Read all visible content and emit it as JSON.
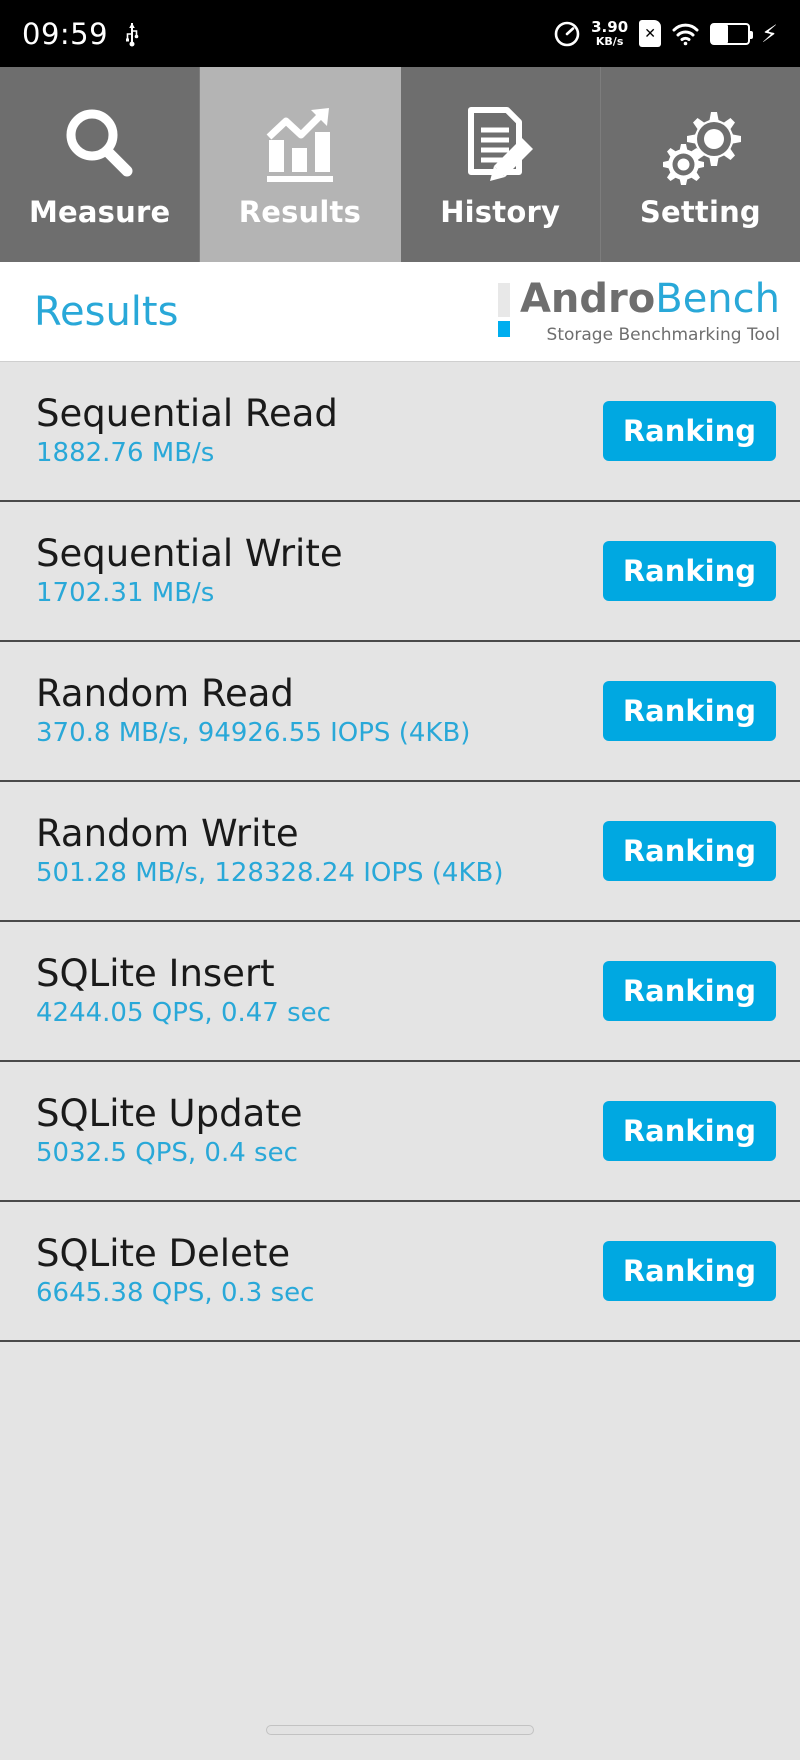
{
  "statusbar": {
    "clock": "09:59",
    "usb_icon": "usb-icon",
    "speed_icon": "speedometer-icon",
    "net_rate_value": "3.90",
    "net_rate_unit": "KB/s",
    "sim_icon": "sim-card-disabled-icon",
    "wifi_icon": "wifi-icon",
    "battery_icon": "battery-icon",
    "battery_level_percent": 45,
    "charging_icon": "lightning-bolt-icon"
  },
  "tabs": [
    {
      "label": "Measure",
      "icon": "magnifier-icon",
      "active": false
    },
    {
      "label": "Results",
      "icon": "bar-chart-arrow-icon",
      "active": true
    },
    {
      "label": "History",
      "icon": "document-pencil-icon",
      "active": false
    },
    {
      "label": "Setting",
      "icon": "gears-icon",
      "active": false
    }
  ],
  "header": {
    "title": "Results",
    "logo_andro": "Andro",
    "logo_bench": "Bench",
    "logo_tagline": "Storage Benchmarking Tool"
  },
  "colors": {
    "accent_blue": "#29a8d8",
    "button_blue": "#00a8e1",
    "logo_gray": "#6e6e6e",
    "tab_inactive": "#6e6e6e",
    "tab_active": "#b4b4b4",
    "list_background": "#e4e4e4",
    "row_divider": "#4a4a4a"
  },
  "results": {
    "ranking_label": "Ranking",
    "rows": [
      {
        "title": "Sequential Read",
        "value": "1882.76 MB/s"
      },
      {
        "title": "Sequential Write",
        "value": "1702.31 MB/s"
      },
      {
        "title": "Random Read",
        "value": "370.8 MB/s, 94926.55 IOPS (4KB)"
      },
      {
        "title": "Random Write",
        "value": "501.28 MB/s, 128328.24 IOPS (4KB)"
      },
      {
        "title": "SQLite Insert",
        "value": "4244.05 QPS, 0.47 sec"
      },
      {
        "title": "SQLite Update",
        "value": "5032.5 QPS, 0.4 sec"
      },
      {
        "title": "SQLite Delete",
        "value": "6645.38 QPS, 0.3 sec"
      }
    ]
  },
  "navbar": {
    "gesture_pill": "gesture-home-pill"
  }
}
